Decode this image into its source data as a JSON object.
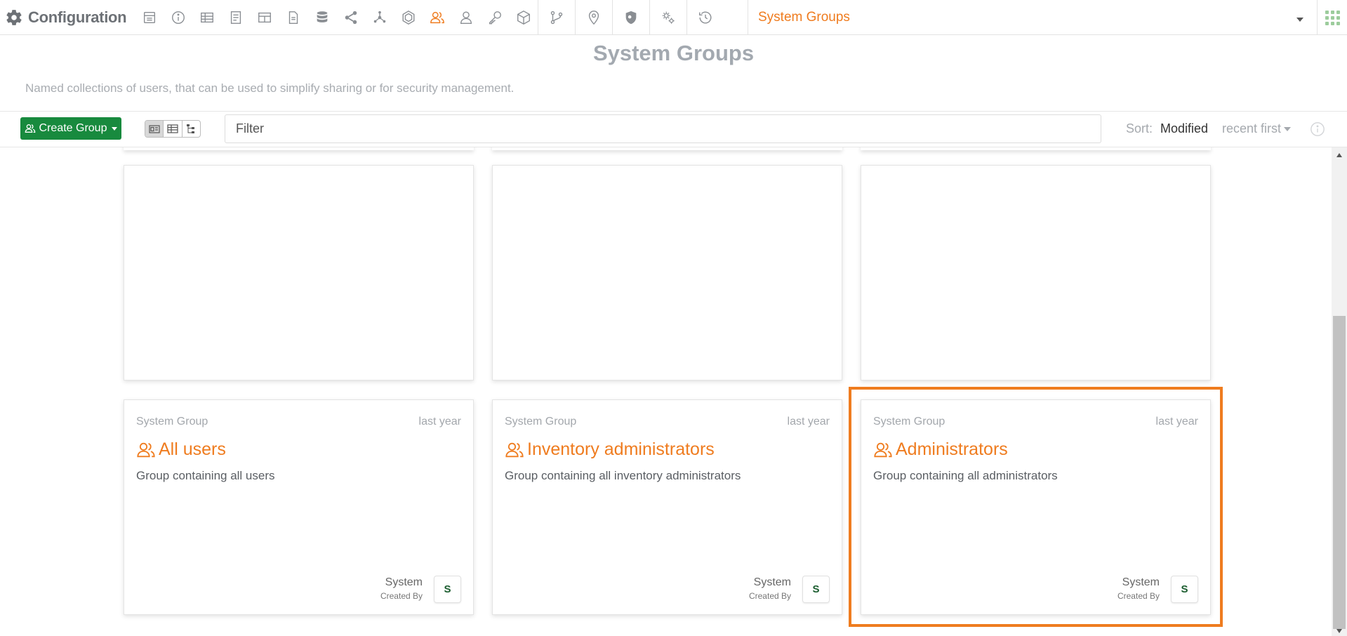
{
  "app": {
    "title": "Configuration",
    "context_label": "System Groups",
    "nav_icons": [
      "dashboard-icon",
      "info-icon",
      "table-icon",
      "document-icon",
      "grid-icon",
      "file-icon",
      "database-icon",
      "share-icon",
      "network-icon",
      "hex-icon",
      "users-icon",
      "user-icon",
      "key-icon",
      "cube-icon"
    ]
  },
  "header": {
    "title": "System Groups",
    "description": "Named collections of users, that can be used to simplify sharing or for security management."
  },
  "toolbar": {
    "create_label": "Create Group",
    "filter_placeholder": "Filter",
    "sort_label": "Sort:",
    "sort_value": "Modified",
    "sort_order": "recent first"
  },
  "cards": [
    {
      "type": "System Group",
      "time": "last year",
      "name": "All users",
      "description": "Group containing all users",
      "owner": "System",
      "owner_label": "Created By",
      "avatar": "S"
    },
    {
      "type": "System Group",
      "time": "last year",
      "name": "Inventory administrators",
      "description": "Group containing all inventory administrators",
      "owner": "System",
      "owner_label": "Created By",
      "avatar": "S"
    },
    {
      "type": "System Group",
      "time": "last year",
      "name": "Administrators",
      "description": "Group containing all administrators",
      "owner": "System",
      "owner_label": "Created By",
      "avatar": "S"
    }
  ],
  "colors": {
    "accent": "#ef7c1f",
    "primary": "#188a3e",
    "muted": "#a3a9b0"
  }
}
